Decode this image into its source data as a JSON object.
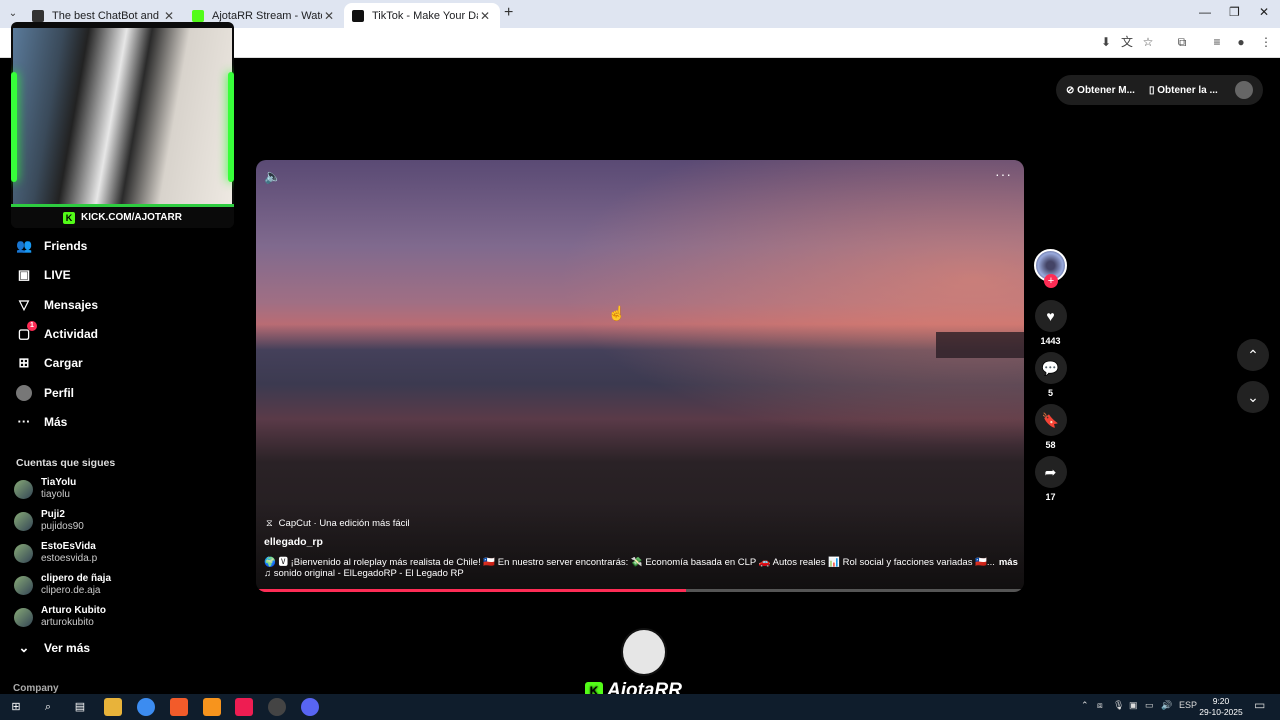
{
  "browser": {
    "tabs": [
      {
        "title": "The best ChatBot and Widgets",
        "active": false
      },
      {
        "title": "AjotaRR Stream - Watch Live on",
        "active": false
      },
      {
        "title": "TikTok - Make Your Day",
        "active": true
      }
    ]
  },
  "overlay": {
    "cam_label": "KICK.COM/AJOTARR",
    "brand_letter": "K",
    "brand_name": "AjotaRR"
  },
  "sidebar": {
    "nav": [
      {
        "label": "Friends",
        "icon": "friends-icon"
      },
      {
        "label": "LIVE",
        "icon": "live-icon"
      },
      {
        "label": "Mensajes",
        "icon": "messages-icon"
      },
      {
        "label": "Actividad",
        "icon": "activity-icon",
        "badge": "1"
      },
      {
        "label": "Cargar",
        "icon": "upload-icon"
      },
      {
        "label": "Perfil",
        "icon": "profile-icon"
      },
      {
        "label": "Más",
        "icon": "more-icon"
      }
    ],
    "following_heading": "Cuentas que sigues",
    "following": [
      {
        "name": "TiaYolu",
        "handle": "tiayolu"
      },
      {
        "name": "Puji2",
        "handle": "pujidos90"
      },
      {
        "name": "EstoEsVida",
        "handle": "estoesvida.p"
      },
      {
        "name": "clipero de ñaja",
        "handle": "clipero.de.aja"
      },
      {
        "name": "Arturo Kubito",
        "handle": "arturokubito"
      }
    ],
    "see_more": "Ver más",
    "company": "Company"
  },
  "header": {
    "btn_get_coins": "Obtener M...",
    "btn_get_app": "Obtener la ..."
  },
  "video": {
    "capcut": "CapCut · Una edición más fácil",
    "author": "ellegado_rp",
    "description": "🌍 🆅 ¡Bienvenido al roleplay más realista de Chile! 🇨🇱 En nuestro server encontrarás: 💸 Economía basada en CLP 🚗 Autos reales 📊 Rol social y facciones variadas 🇨🇱...",
    "more_label": "más",
    "sound": "sonido original - ElLegadoRP - El Legado RP",
    "progress": 0.56
  },
  "actions": {
    "likes": "1443",
    "comments": "5",
    "saves": "58",
    "shares": "17"
  },
  "taskbar": {
    "lang": "ESP",
    "time": "9:20",
    "date": "29-10-2025"
  }
}
